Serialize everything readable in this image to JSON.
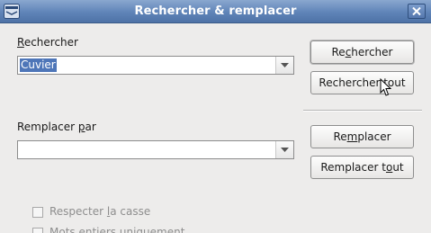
{
  "window": {
    "title": "Rechercher & remplacer"
  },
  "icons": {
    "app": "office-app-icon",
    "close": "close-icon",
    "dropdown": "chevron-down-icon",
    "cursor": "mouse-pointer-icon"
  },
  "search": {
    "label_accel": "R",
    "label_rest": "echercher",
    "value": "Cuvier"
  },
  "replace": {
    "label_pre": "Remplacer ",
    "label_accel": "p",
    "label_rest": "ar",
    "value": ""
  },
  "buttons": {
    "find": {
      "pre": "Re",
      "accel": "c",
      "post": "hercher"
    },
    "find_all": {
      "pre": "Rechercher ",
      "accel": "t",
      "post": "out"
    },
    "replace": {
      "pre": "Re",
      "accel": "m",
      "post": "placer"
    },
    "replace_all": {
      "pre": "Remplacer t",
      "accel": "o",
      "post": "ut"
    }
  },
  "options": {
    "match_case": {
      "pre": "Respecter ",
      "accel": "l",
      "post": "a casse",
      "checked": false
    },
    "whole_words": {
      "text": "Mots entiers uniquement",
      "checked": false
    }
  },
  "colors": {
    "titlebar": "#5f84b8",
    "selection": "#4e76b8",
    "dialog_bg": "#edeceb"
  }
}
